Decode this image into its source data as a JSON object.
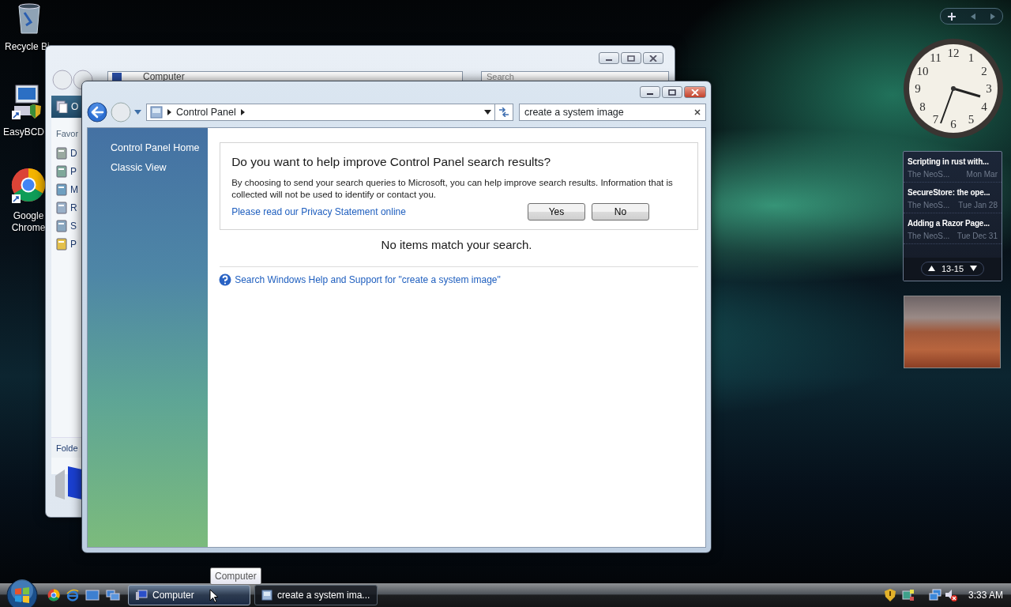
{
  "desktop_icons": [
    {
      "kind": "recycle",
      "label": "Recycle Bi"
    },
    {
      "kind": "easybcd",
      "label": "EasyBCD"
    },
    {
      "kind": "chrome",
      "label": "Google Chrome"
    }
  ],
  "background_window": {
    "address": "Computer",
    "search_placeholder": "Search",
    "toolbar_label": "O",
    "pane_heading": "Favor",
    "pane_items": [
      {
        "kind": "doc",
        "label": "D"
      },
      {
        "kind": "pic",
        "label": "P"
      },
      {
        "kind": "music",
        "label": "M"
      },
      {
        "kind": "recent",
        "label": "R"
      },
      {
        "kind": "search",
        "label": "S"
      },
      {
        "kind": "folder",
        "label": "P"
      }
    ],
    "folders_label": "Folde"
  },
  "window": {
    "breadcrumbs": [
      "Control Panel"
    ],
    "search_value": "create a system image",
    "sidebar": {
      "items": [
        {
          "label": "Control Panel Home"
        },
        {
          "label": "Classic View"
        }
      ]
    },
    "prompt": {
      "title": "Do you want to help improve Control Panel search results?",
      "body": "By choosing to send your search queries to Microsoft, you can help improve search results. Information that is collected will not be used to identify or contact you.",
      "link": "Please read our Privacy Statement online",
      "buttons": [
        "Yes",
        "No"
      ]
    },
    "no_results": "No items match your search.",
    "help_link": "Search Windows Help and Support for \"create a system image\""
  },
  "gadgets": {
    "clock": {
      "numerals": [
        "12",
        "1",
        "2",
        "3",
        "4",
        "5",
        "6",
        "7",
        "8",
        "9",
        "10",
        "11"
      ]
    },
    "feed": {
      "items": [
        {
          "title": "Scripting in rust with...",
          "source": "The NeoS...",
          "date": "Mon Mar"
        },
        {
          "title": "SecureStore: the ope...",
          "source": "The NeoS...",
          "date": "Tue Jan 28"
        },
        {
          "title": "Adding a Razor Page...",
          "source": "The NeoS...",
          "date": "Tue Dec 31"
        }
      ],
      "pager": "13-15"
    }
  },
  "taskbar": {
    "buttons": [
      {
        "label": "Computer",
        "kind": "computer",
        "selected": true
      },
      {
        "label": "create a system ima...",
        "kind": "controlpanel",
        "selected": false
      }
    ],
    "tooltip": "Computer",
    "clock": "3:33 AM"
  }
}
